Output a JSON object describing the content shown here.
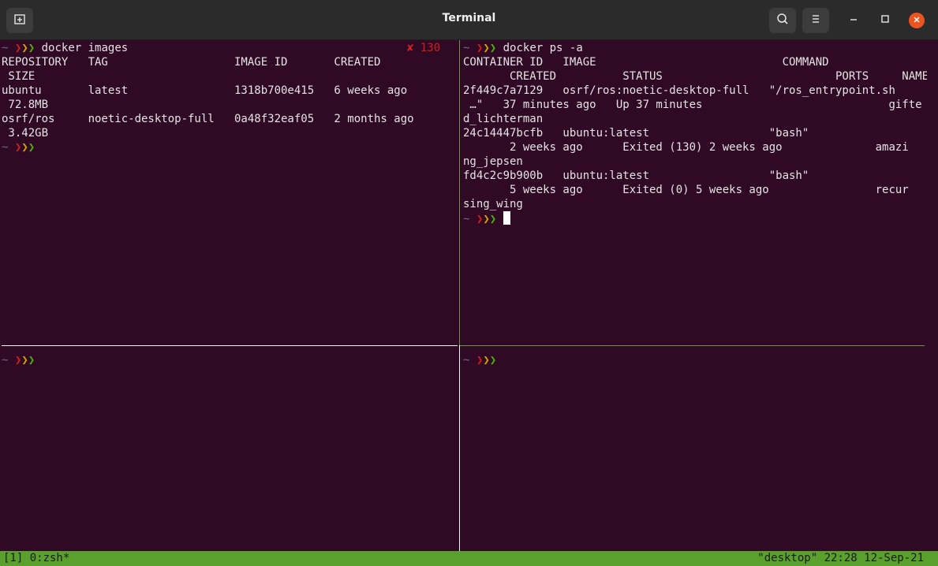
{
  "window": {
    "title": "Terminal"
  },
  "prompt": {
    "tilde": "~",
    "arrows": [
      "❯",
      "❯",
      "❯"
    ]
  },
  "panes": {
    "top_left": {
      "command": "docker images",
      "exit_status_icon": "✘",
      "exit_status_code": "130",
      "output": [
        "REPOSITORY   TAG                   IMAGE ID       CREATED",
        " SIZE",
        "ubuntu       latest                1318b700e415   6 weeks ago",
        " 72.8MB",
        "osrf/ros     noetic-desktop-full   0a48f32eaf05   2 months ago",
        " 3.42GB"
      ]
    },
    "top_right": {
      "command": "docker ps -a",
      "output": [
        "CONTAINER ID   IMAGE                            COMMAND",
        "       CREATED          STATUS                          PORTS     NAMES",
        "2f449c7a7129   osrf/ros:noetic-desktop-full   \"/ros_entrypoint.sh",
        " …\"   37 minutes ago   Up 37 minutes                            gifte",
        "d_lichterman",
        "24c14447bcfb   ubuntu:latest                  \"bash\"",
        "       2 weeks ago      Exited (130) 2 weeks ago              amazi",
        "ng_jepsen",
        "fd4c2c9b900b   ubuntu:latest                  \"bash\"",
        "       5 weeks ago      Exited (0) 5 weeks ago                recur",
        "sing_wing"
      ]
    }
  },
  "statusbar": {
    "left": "[1] 0:zsh*",
    "right": "\"desktop\" 22:28 12-Sep-21"
  },
  "colors": {
    "terminal_bg": "#300a24",
    "titlebar_bg": "#2b2b2b",
    "status_bg": "#5aa02c",
    "active_border": "#5aa02c",
    "inactive_border": "#ffffff",
    "prompt_arrow_1": "#d11f1f",
    "prompt_arrow_2": "#cfa50c",
    "prompt_arrow_3": "#4bb40c"
  },
  "icons": {
    "new_tab": "new-tab-icon",
    "search": "search-icon",
    "menu": "hamburger-menu-icon",
    "minimize": "minimize-icon",
    "maximize": "maximize-icon",
    "close": "close-icon"
  }
}
